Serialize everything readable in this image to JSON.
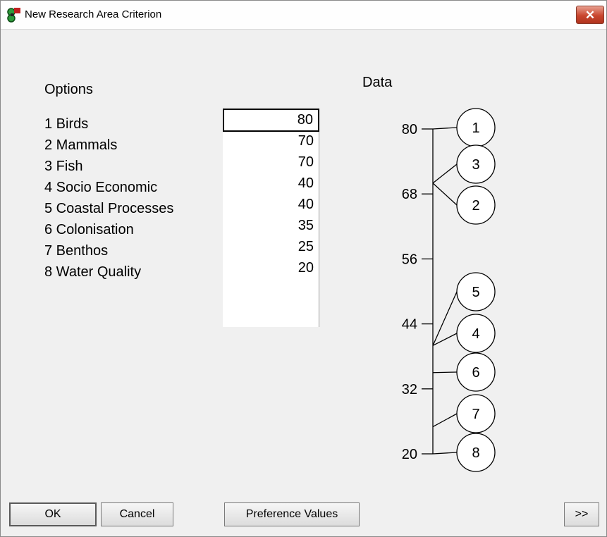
{
  "window": {
    "title": "New Research Area Criterion",
    "close_glyph": "✕",
    "icon": "app-logo-icon"
  },
  "options": {
    "heading": "Options",
    "items": [
      {
        "label": "1 Birds",
        "value": "80"
      },
      {
        "label": "2 Mammals",
        "value": "70"
      },
      {
        "label": "3 Fish",
        "value": "70"
      },
      {
        "label": "4 Socio Economic",
        "value": "40"
      },
      {
        "label": "5 Coastal Processes",
        "value": "40"
      },
      {
        "label": "6 Colonisation",
        "value": "35"
      },
      {
        "label": "7 Benthos",
        "value": "25"
      },
      {
        "label": "8 Water Quality",
        "value": "20"
      }
    ],
    "selected_index": 0
  },
  "data_panel": {
    "heading": "Data"
  },
  "chart_data": {
    "type": "scatter",
    "ylabel": "",
    "ylim": [
      20,
      80
    ],
    "yticks": [
      "80",
      "68",
      "56",
      "44",
      "32",
      "20"
    ],
    "points": [
      {
        "label": "1",
        "value": 80
      },
      {
        "label": "3",
        "value": 70
      },
      {
        "label": "2",
        "value": 70
      },
      {
        "label": "5",
        "value": 40
      },
      {
        "label": "4",
        "value": 40
      },
      {
        "label": "6",
        "value": 35
      },
      {
        "label": "7",
        "value": 25
      },
      {
        "label": "8",
        "value": 20
      }
    ]
  },
  "buttons": {
    "ok": "OK",
    "cancel": "Cancel",
    "preference_values": "Preference Values",
    "more": ">>"
  },
  "colors": {
    "close_button": "#c9462e",
    "background": "#f0f0f0"
  }
}
